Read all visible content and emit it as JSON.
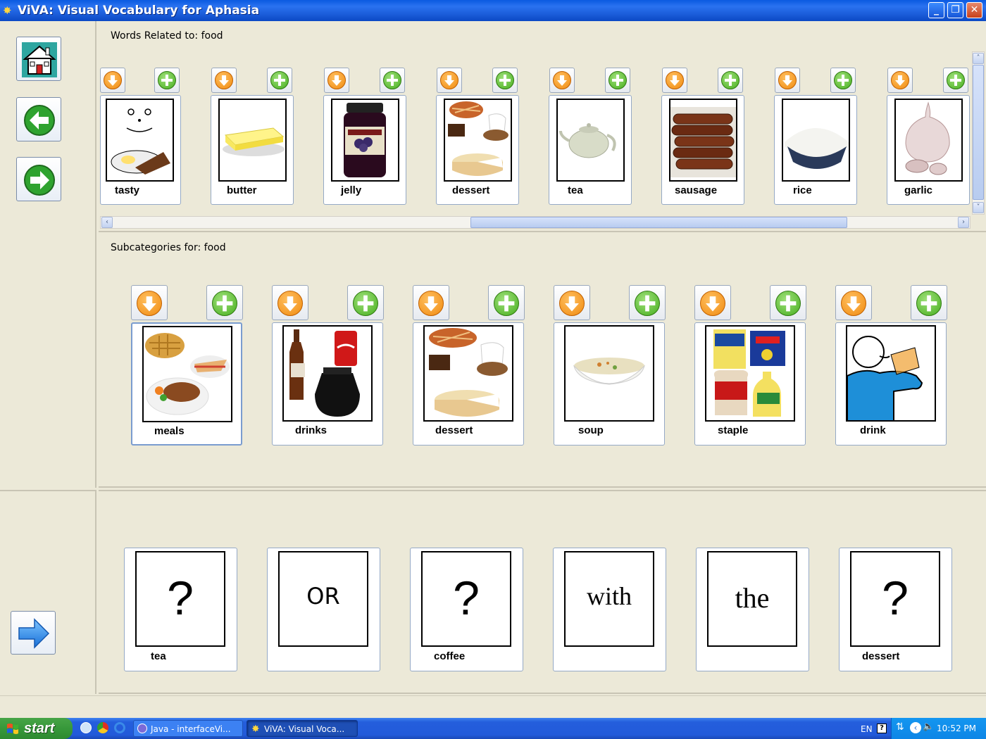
{
  "window": {
    "title": "ViVA: Visual Vocabulary for Aphasia",
    "controls": [
      "_",
      "❐",
      "✕"
    ]
  },
  "words_panel": {
    "label": "Words Related to: food",
    "items": [
      {
        "label": "tasty"
      },
      {
        "label": "butter"
      },
      {
        "label": "jelly"
      },
      {
        "label": "dessert"
      },
      {
        "label": "tea"
      },
      {
        "label": "sausage"
      },
      {
        "label": "rice"
      },
      {
        "label": "garlic"
      }
    ]
  },
  "subcategories_panel": {
    "label": "Subcategories for: food",
    "items": [
      {
        "label": "meals"
      },
      {
        "label": "drinks"
      },
      {
        "label": "dessert"
      },
      {
        "label": "soup"
      },
      {
        "label": "staple"
      },
      {
        "label": "drink"
      }
    ]
  },
  "sentence": {
    "tiles": [
      {
        "symbol": "?",
        "label": "tea"
      },
      {
        "symbol": "OR",
        "label": ""
      },
      {
        "symbol": "?",
        "label": "coffee"
      },
      {
        "symbol": "with",
        "label": ""
      },
      {
        "symbol": "the",
        "label": ""
      },
      {
        "symbol": "?",
        "label": "dessert"
      }
    ]
  },
  "taskbar": {
    "start_label": "start",
    "tasks": [
      {
        "label": "Java - interfaceVi..."
      },
      {
        "label": "ViVA: Visual Voca..."
      }
    ],
    "tray": {
      "lang": "EN",
      "time": "10:52 PM"
    }
  },
  "colors": {
    "titlebar": "#0A5AE0",
    "panel_bg": "#ECE9D8",
    "add_button": "#46AE1E",
    "down_button": "#F08A10"
  }
}
